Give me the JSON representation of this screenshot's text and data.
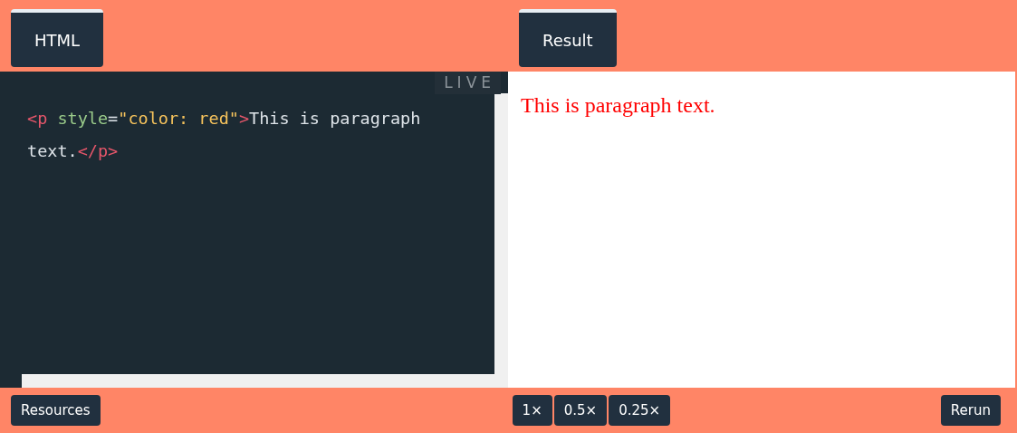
{
  "editor": {
    "tab": "HTML",
    "badge": "LIVE",
    "code": [
      {
        "kind": "tag",
        "text": "<p"
      },
      {
        "kind": "attr",
        "text": " style"
      },
      {
        "kind": "plain",
        "text": "="
      },
      {
        "kind": "string",
        "text": "\"color: red\""
      },
      {
        "kind": "tag",
        "text": ">"
      },
      {
        "kind": "plain",
        "text": "This is paragraph text."
      },
      {
        "kind": "tag",
        "text": "</p>"
      }
    ]
  },
  "result": {
    "tab": "Result",
    "text": "This is paragraph text."
  },
  "footer": {
    "resources": "Resources",
    "zoom": [
      "1×",
      "0.5×",
      "0.25×"
    ],
    "rerun": "Rerun"
  }
}
